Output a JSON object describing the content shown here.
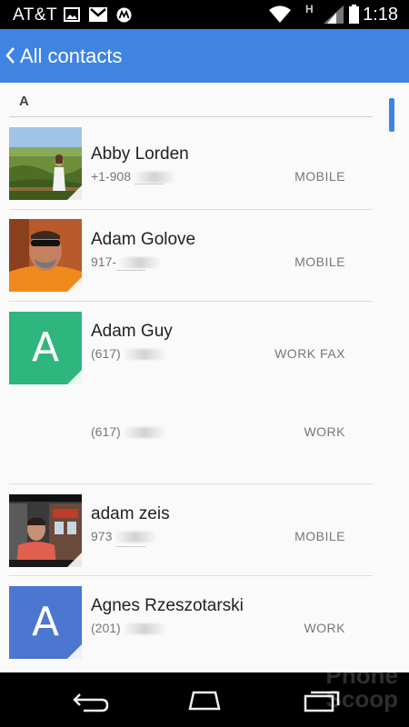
{
  "status_bar": {
    "carrier": "AT&T",
    "signal_type": "H",
    "time": "1:18",
    "icons": [
      "image-icon",
      "gmail-icon",
      "motorola-icon",
      "wifi-icon",
      "signal-icon",
      "battery-icon"
    ]
  },
  "app_bar": {
    "back_icon": "chevron-left-icon",
    "title": "All contacts"
  },
  "section": {
    "letter": "A"
  },
  "contacts": [
    {
      "name": "Abby Lorden",
      "number": "+1-908",
      "type": "MOBILE"
    },
    {
      "name": "Adam Golove",
      "number": "917-",
      "type": "MOBILE"
    },
    {
      "name": "Adam Guy",
      "avatar_letter": "A",
      "avatar_color": "#2fb57e",
      "number": "(617)",
      "type": "WORK FAX",
      "number2": "(617)",
      "type2": "WORK"
    },
    {
      "name": "adam zeis",
      "number": "973",
      "type": "MOBILE"
    },
    {
      "name": "Agnes Rzeszotarski",
      "avatar_letter": "A",
      "avatar_color": "#4b77d1",
      "number": "(201)",
      "type": "WORK"
    }
  ],
  "nav": {
    "back": "nav-back-icon",
    "home": "nav-home-icon",
    "recents": "nav-recents-icon"
  },
  "watermark": {
    "line1": "Phone",
    "line2": "Scoop"
  },
  "colors": {
    "accent": "#3f84e3",
    "green_avatar": "#2fb57e",
    "blue_avatar": "#4b77d1"
  }
}
